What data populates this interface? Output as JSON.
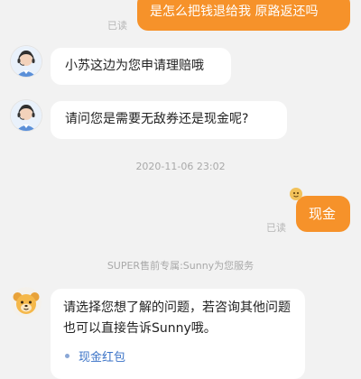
{
  "chat": {
    "messages": [
      {
        "side": "right",
        "text": "是怎么把钱退给我 原路返还吗",
        "status": "已读"
      },
      {
        "side": "left",
        "text": "小苏这边为您申请理赔哦"
      },
      {
        "side": "left",
        "text": "请问您是需要无敌券还是现金呢?"
      },
      {
        "side": "time",
        "text": "2020-11-06 23:02"
      },
      {
        "side": "right",
        "text": "现金",
        "status": "已读"
      },
      {
        "side": "system",
        "text": "SUPER售前专属:Sunny为您服务"
      },
      {
        "side": "left",
        "text": "请选择您想了解的问题，若咨询其他问题也可以直接告诉Sunny哦。",
        "options": [
          "现金红包"
        ]
      }
    ]
  },
  "colors": {
    "background": "#f2f2f2",
    "user_bubble": "#f6922a",
    "agent_bubble": "#ffffff",
    "link": "#3b73c7"
  }
}
